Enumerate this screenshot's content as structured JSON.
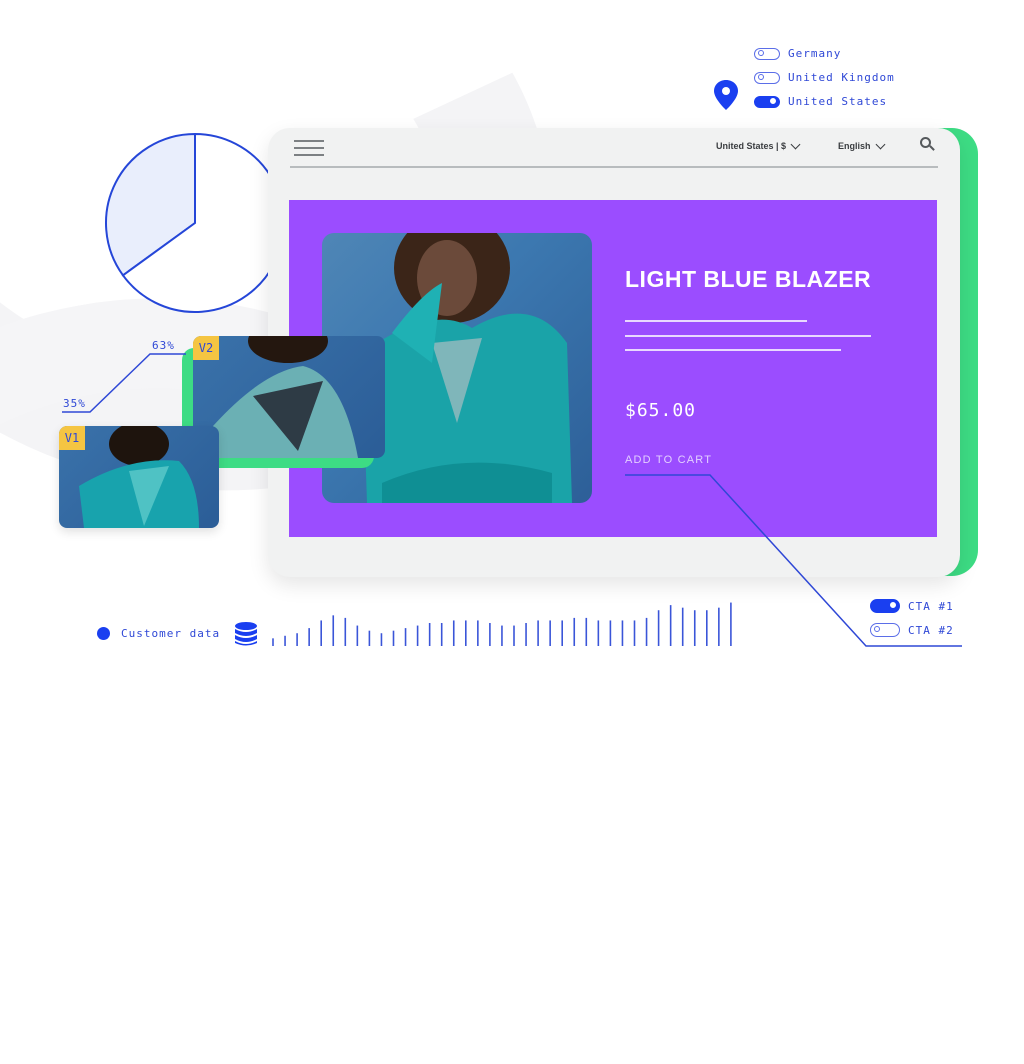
{
  "region_toggles": [
    {
      "label": "Germany",
      "on": false
    },
    {
      "label": "United Kingdom",
      "on": false
    },
    {
      "label": "United States",
      "on": true
    }
  ],
  "location_icon": "map-pin-icon",
  "store": {
    "nav": {
      "menu_icon": "hamburger-icon",
      "region_selector": "United States | $",
      "language_selector": "English",
      "search_icon": "search-icon"
    },
    "product": {
      "title": "LIGHT BLUE BLAZER",
      "price": "$65.00",
      "cta_label": "ADD TO CART"
    }
  },
  "variants": [
    {
      "label": "V1",
      "conversion": "35%"
    },
    {
      "label": "V2",
      "conversion": "63%"
    }
  ],
  "cta_toggles": [
    {
      "label": "CTA #1",
      "on": true
    },
    {
      "label": "CTA #2",
      "on": false
    }
  ],
  "customer_data": {
    "label": "Customer data",
    "icon": "database-icon"
  },
  "colors": {
    "accent_blue": "#1a3ff0",
    "hero_purple": "#9b4dff",
    "accent_green": "#3ddc84",
    "badge_yellow": "#f5c542"
  },
  "chart_data": [
    {
      "type": "pie",
      "title": "",
      "slices": [
        {
          "label": "highlighted",
          "value": 35
        },
        {
          "label": "rest",
          "value": 65
        }
      ]
    },
    {
      "type": "bar",
      "title": "Customer data",
      "categories": [],
      "values": [
        3,
        4,
        5,
        7,
        10,
        12,
        11,
        8,
        6,
        5,
        6,
        7,
        8,
        9,
        9,
        10,
        10,
        10,
        9,
        8,
        8,
        9,
        10,
        10,
        10,
        11,
        11,
        10,
        10,
        10,
        10,
        11,
        14,
        16,
        15,
        14,
        14,
        15,
        17
      ],
      "ylim": [
        0,
        18
      ]
    }
  ]
}
